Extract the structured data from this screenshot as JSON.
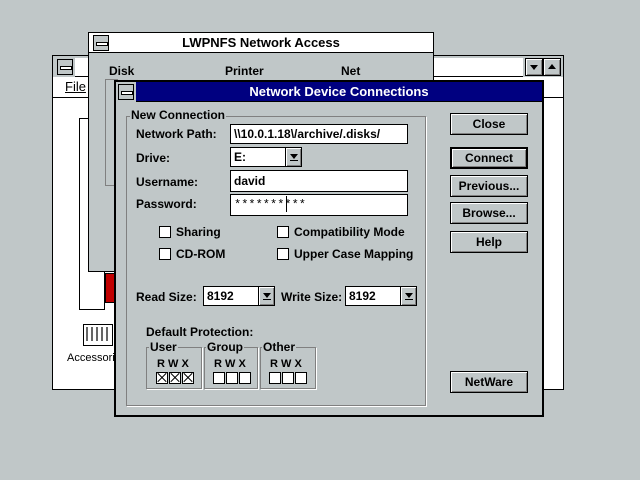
{
  "background_window": {
    "menu_file": "File",
    "icon_caption": "Accessori"
  },
  "lwpnfs": {
    "title": "LWPNFS Network Access",
    "tab_disk": "Disk",
    "tab_printer": "Printer",
    "tab_net": "Net"
  },
  "dialog": {
    "title": "Network Device Connections",
    "group_title": "New Connection",
    "network_path_label": "Network Path:",
    "network_path_value": "\\\\10.0.1.18\\/archive/.disks/",
    "drive_label": "Drive:",
    "drive_value": "E:",
    "username_label": "Username:",
    "username_value": "david",
    "password_label": "Password:",
    "password_value": "**********",
    "sharing_label": "Sharing",
    "cdrom_label": "CD-ROM",
    "compat_label": "Compatibility Mode",
    "upper_label": "Upper Case Mapping",
    "read_size_label": "Read Size:",
    "read_size_value": "8192",
    "write_size_label": "Write Size:",
    "write_size_value": "8192",
    "protection_label": "Default Protection:",
    "user_label": "User",
    "group_label": "Group",
    "other_label": "Other",
    "rwx": "R W X",
    "buttons": {
      "close": "Close",
      "connect": "Connect",
      "previous": "Previous...",
      "browse": "Browse...",
      "help": "Help",
      "netware": "NetWare"
    },
    "protection": {
      "user": [
        true,
        true,
        true
      ],
      "group": [
        false,
        false,
        false
      ],
      "other": [
        false,
        false,
        false
      ]
    }
  }
}
